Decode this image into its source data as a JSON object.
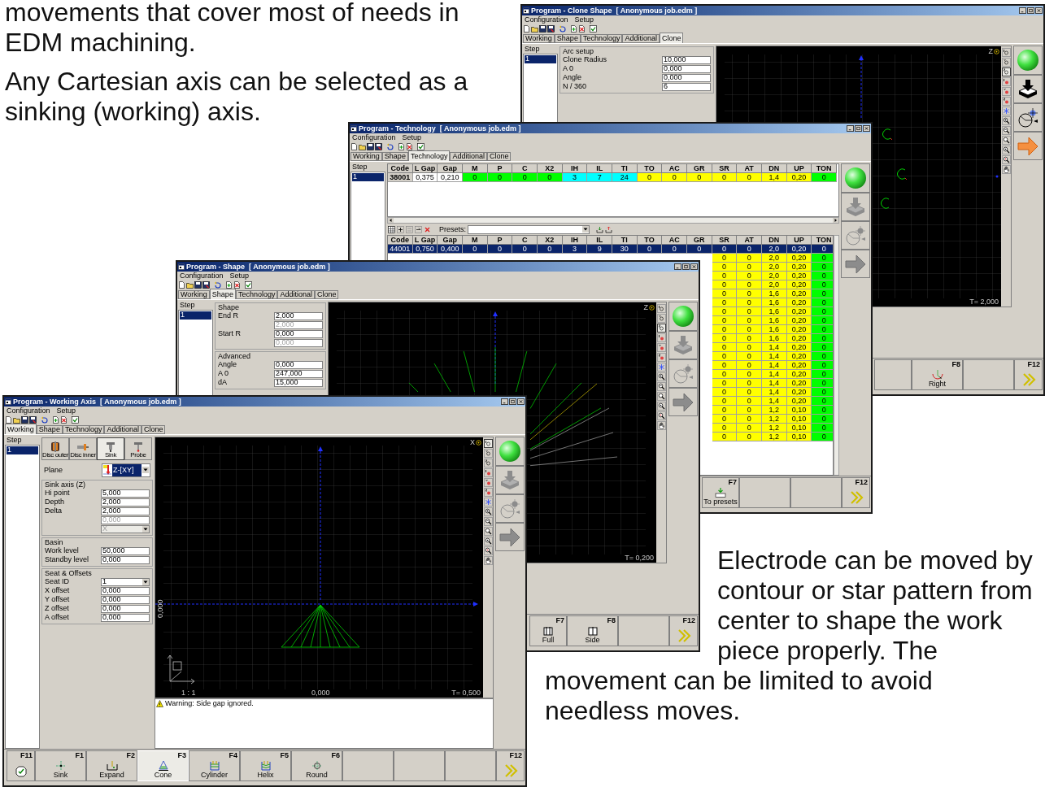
{
  "captions": [
    {
      "text": "movements that cover most of needs in EDM machining."
    },
    {
      "text": "Any Cartesian axis can be selected as a sinking (working) axis."
    },
    {
      "text": "Electrode can be moved by contour or star pattern from center to shape the work piece properly. The"
    },
    {
      "text": "movement can be limited to avoid needless moves."
    }
  ],
  "windows": [
    {
      "kind": "clone",
      "title": "Program - Clone Shape  [ Anonymous job.edm ]",
      "menu": [
        "Configuration",
        "Setup"
      ],
      "tabs": [
        {
          "label": "Working",
          "selected": false
        },
        {
          "label": "Shape",
          "selected": false
        },
        {
          "label": "Technology",
          "selected": false
        },
        {
          "label": "Additional",
          "selected": false
        },
        {
          "label": "Clone",
          "selected": true
        }
      ],
      "step_header": "Step",
      "steps": [
        {
          "label": "1",
          "selected": true
        }
      ],
      "groups": [
        {
          "title": "Arc setup",
          "fields": [
            {
              "label": "Clone Radius",
              "value": "10,000",
              "kind": "text",
              "disabled": false
            },
            {
              "label": "A 0",
              "value": "0,000",
              "kind": "text",
              "disabled": false
            },
            {
              "label": "Angle",
              "value": "0,000",
              "kind": "text",
              "disabled": false
            },
            {
              "label": "N / 360",
              "value": "6",
              "kind": "text",
              "disabled": false
            }
          ]
        }
      ],
      "canvas": {
        "axis_label": "Z",
        "time": "T= 2,000"
      },
      "views": [
        {
          "selected": false
        },
        {
          "selected": false
        },
        {
          "selected": true
        },
        {
          "selected": false
        },
        {
          "selected": false
        },
        {
          "selected": false
        }
      ],
      "actions": [
        {
          "disabled": false
        },
        {
          "disabled": false
        },
        {
          "disabled": false
        }
      ],
      "fkeys": [
        {
          "kind": "blank",
          "selected": false
        },
        {
          "kind": "key",
          "key": "F8",
          "label": "Right",
          "selected": false
        },
        {
          "kind": "blank",
          "selected": false
        },
        {
          "kind": "next",
          "key": "F12",
          "selected": false
        }
      ]
    },
    {
      "kind": "technology",
      "title": "Program - Technology  [ Anonymous job.edm ]",
      "menu": [
        "Configuration",
        "Setup"
      ],
      "tabs": [
        {
          "label": "Working",
          "selected": false
        },
        {
          "label": "Shape",
          "selected": false
        },
        {
          "label": "Technology",
          "selected": true
        },
        {
          "label": "Additional",
          "selected": false
        },
        {
          "label": "Clone",
          "selected": false
        }
      ],
      "step_header": "Step",
      "steps": [
        {
          "label": "1",
          "selected": true
        }
      ],
      "tables": [
        {
          "columns": [
            {
              "label": "Code"
            },
            {
              "label": "L Gap"
            },
            {
              "label": "Gap"
            },
            {
              "label": "M",
              "color": "#00ff00"
            },
            {
              "label": "P",
              "color": "#00ff00"
            },
            {
              "label": "C",
              "color": "#00ff00"
            },
            {
              "label": "X2",
              "color": "#00ff00"
            },
            {
              "label": "IH",
              "color": "#00ffff"
            },
            {
              "label": "IL",
              "color": "#00ffff"
            },
            {
              "label": "TI",
              "color": "#00ffff"
            },
            {
              "label": "TO",
              "color": "#ffff00"
            },
            {
              "label": "AC",
              "color": "#ffff00"
            },
            {
              "label": "GR",
              "color": "#ffff00"
            },
            {
              "label": "SR",
              "color": "#ffff00"
            },
            {
              "label": "AT",
              "color": "#ffff00"
            },
            {
              "label": "DN",
              "color": "#ffff00"
            },
            {
              "label": "UP",
              "color": "#ffff00"
            },
            {
              "label": "TON",
              "color": "#00ff00"
            }
          ],
          "rows": [
            {
              "selected": false,
              "cells": [
                "38001",
                "0,375",
                "0,210",
                "0",
                "0",
                "0",
                "0",
                "3",
                "7",
                "24",
                "0",
                "0",
                "0",
                "0",
                "0",
                "1,4",
                "0,20",
                "0"
              ]
            }
          ]
        },
        {
          "columns": [
            {
              "label": "Code"
            },
            {
              "label": "L Gap"
            },
            {
              "label": "Gap"
            },
            {
              "label": "M"
            },
            {
              "label": "P"
            },
            {
              "label": "C"
            },
            {
              "label": "X2"
            },
            {
              "label": "IH"
            },
            {
              "label": "IL"
            },
            {
              "label": "TI"
            },
            {
              "label": "TO"
            },
            {
              "label": "AC"
            },
            {
              "label": "GR"
            },
            {
              "label": "SR",
              "color": "#ffff00"
            },
            {
              "label": "AT",
              "color": "#ffff00"
            },
            {
              "label": "DN",
              "color": "#ffff00"
            },
            {
              "label": "UP",
              "color": "#ffff00"
            },
            {
              "label": "TON",
              "color": "#00ff00"
            }
          ],
          "rows": [
            {
              "selected": true,
              "cells": [
                "44001",
                "0,750",
                "0,400",
                "0",
                "0",
                "0",
                "0",
                "3",
                "9",
                "30",
                "0",
                "0",
                "0",
                "0",
                "0",
                "2,0",
                "0,20",
                "0"
              ]
            },
            {
              "selected": false,
              "cells": [
                "0",
                "0",
                "2,0",
                "0,20",
                "0"
              ]
            },
            {
              "selected": false,
              "cells": [
                "0",
                "0",
                "2,0",
                "0,20",
                "0"
              ]
            },
            {
              "selected": false,
              "cells": [
                "0",
                "0",
                "2,0",
                "0,20",
                "0"
              ]
            },
            {
              "selected": false,
              "cells": [
                "0",
                "0",
                "2,0",
                "0,20",
                "0"
              ]
            },
            {
              "selected": false,
              "cells": [
                "0",
                "0",
                "1,6",
                "0,20",
                "0"
              ]
            },
            {
              "selected": false,
              "cells": [
                "0",
                "0",
                "1,6",
                "0,20",
                "0"
              ]
            },
            {
              "selected": false,
              "cells": [
                "0",
                "0",
                "1,6",
                "0,20",
                "0"
              ]
            },
            {
              "selected": false,
              "cells": [
                "0",
                "0",
                "1,6",
                "0,20",
                "0"
              ]
            },
            {
              "selected": false,
              "cells": [
                "0",
                "0",
                "1,6",
                "0,20",
                "0"
              ]
            },
            {
              "selected": false,
              "cells": [
                "0",
                "0",
                "1,6",
                "0,20",
                "0"
              ]
            },
            {
              "selected": false,
              "cells": [
                "0",
                "0",
                "1,4",
                "0,20",
                "0"
              ]
            },
            {
              "selected": false,
              "cells": [
                "0",
                "0",
                "1,4",
                "0,20",
                "0"
              ]
            },
            {
              "selected": false,
              "cells": [
                "0",
                "0",
                "1,4",
                "0,20",
                "0"
              ]
            },
            {
              "selected": false,
              "cells": [
                "0",
                "0",
                "1,4",
                "0,20",
                "0"
              ]
            },
            {
              "selected": false,
              "cells": [
                "0",
                "0",
                "1,4",
                "0,20",
                "0"
              ]
            },
            {
              "selected": false,
              "cells": [
                "0",
                "0",
                "1,4",
                "0,20",
                "0"
              ]
            },
            {
              "selected": false,
              "cells": [
                "0",
                "0",
                "1,4",
                "0,20",
                "0"
              ]
            },
            {
              "selected": false,
              "cells": [
                "0",
                "0",
                "1,2",
                "0,10",
                "0"
              ]
            },
            {
              "selected": false,
              "cells": [
                "0",
                "0",
                "1,2",
                "0,10",
                "0"
              ]
            },
            {
              "selected": false,
              "cells": [
                "0",
                "0",
                "1,2",
                "0,10",
                "0"
              ]
            },
            {
              "selected": false,
              "cells": [
                "0",
                "0",
                "1,2",
                "0,10",
                "0"
              ]
            }
          ]
        }
      ],
      "presets": {
        "label": "Presets:"
      },
      "actions": [
        {
          "disabled": true
        },
        {
          "disabled": true
        },
        {
          "disabled": true
        }
      ],
      "fkeys": [
        {
          "kind": "key",
          "key": "F7",
          "label": "To presets",
          "selected": false
        },
        {
          "kind": "blank",
          "selected": false
        },
        {
          "kind": "blank",
          "selected": false
        },
        {
          "kind": "next",
          "key": "F12",
          "selected": false
        }
      ]
    },
    {
      "kind": "shape",
      "title": "Program - Shape  [ Anonymous job.edm ]",
      "menu": [
        "Configuration",
        "Setup"
      ],
      "tabs": [
        {
          "label": "Working",
          "selected": false
        },
        {
          "label": "Shape",
          "selected": true
        },
        {
          "label": "Technology",
          "selected": false
        },
        {
          "label": "Additional",
          "selected": false
        },
        {
          "label": "Clone",
          "selected": false
        }
      ],
      "step_header": "Step",
      "steps": [
        {
          "label": "1",
          "selected": true
        }
      ],
      "groups": [
        {
          "title": "Shape",
          "fields": [
            {
              "label": "End R",
              "value": "2,000",
              "kind": "text",
              "disabled": false
            },
            {
              "value": "2,000",
              "kind": "text",
              "disabled": true
            },
            {
              "label": "Start R",
              "value": "0,000",
              "kind": "text",
              "disabled": false
            },
            {
              "value": "0,000",
              "kind": "text",
              "disabled": true
            }
          ]
        },
        {
          "title": "Advanced",
          "fields": [
            {
              "label": "Angle",
              "value": "0,000",
              "kind": "text",
              "disabled": false
            },
            {
              "label": "A 0",
              "value": "247,000",
              "kind": "text",
              "disabled": false
            },
            {
              "label": "dA",
              "value": "15,000",
              "kind": "text",
              "disabled": false
            }
          ]
        }
      ],
      "canvas": {
        "axis_label": "Z",
        "time": "T= 0,200"
      },
      "views": [
        {
          "selected": false
        },
        {
          "selected": false
        },
        {
          "selected": true
        },
        {
          "selected": false
        },
        {
          "selected": false
        },
        {
          "selected": false
        }
      ],
      "actions": [
        {
          "disabled": true
        },
        {
          "disabled": true
        },
        {
          "disabled": true
        }
      ],
      "fkeys": [
        {
          "kind": "key",
          "key": "F7",
          "label": "Full",
          "selected": false
        },
        {
          "kind": "key",
          "key": "F8",
          "label": "Side",
          "selected": false
        },
        {
          "kind": "blank",
          "selected": false
        },
        {
          "kind": "next",
          "key": "F12",
          "selected": false
        }
      ]
    },
    {
      "kind": "working",
      "title": "Program - Working Axis  [ Anonymous job.edm ]",
      "menu": [
        "Configuration",
        "Setup"
      ],
      "tabs": [
        {
          "label": "Working",
          "selected": true
        },
        {
          "label": "Shape",
          "selected": false
        },
        {
          "label": "Technology",
          "selected": false
        },
        {
          "label": "Additional",
          "selected": false
        },
        {
          "label": "Clone",
          "selected": false
        }
      ],
      "step_header": "Step",
      "steps": [
        {
          "label": "1",
          "selected": true
        }
      ],
      "tools": [
        {
          "label": "Disc outer",
          "selected": false
        },
        {
          "label": "Disc inner",
          "selected": false
        },
        {
          "label": "Sink",
          "selected": true
        },
        {
          "label": "Probe",
          "selected": false
        }
      ],
      "plane": {
        "label": "Plane",
        "value": "Z-[XY]"
      },
      "groups": [
        {
          "title": "Sink axis (Z)",
          "fields": [
            {
              "label": "Hi point",
              "value": "5,000",
              "kind": "text",
              "disabled": false
            },
            {
              "label": "Depth",
              "value": "2,000",
              "kind": "text",
              "disabled": false
            },
            {
              "label": "Delta",
              "value": "2,000",
              "kind": "text",
              "disabled": false
            },
            {
              "value": "0,000",
              "kind": "text",
              "disabled": true
            },
            {
              "value": "X",
              "kind": "dropdown",
              "disabled": true
            }
          ]
        },
        {
          "title": "Basin",
          "fields": [
            {
              "label": "Work level",
              "value": "50,000",
              "kind": "text",
              "disabled": false
            },
            {
              "label": "Standby level",
              "value": "0,000",
              "kind": "text",
              "disabled": false
            }
          ]
        },
        {
          "title": "Seat & Offsets",
          "fields": [
            {
              "label": "Seat ID",
              "value": "1",
              "kind": "dropdown",
              "disabled": false
            },
            {
              "label": "X offset",
              "value": "0,000",
              "kind": "text",
              "disabled": false
            },
            {
              "label": "Y offset",
              "value": "0,000",
              "kind": "text",
              "disabled": false
            },
            {
              "label": "Z offset",
              "value": "0,000",
              "kind": "text",
              "disabled": false
            },
            {
              "label": "A offset",
              "value": "0,000",
              "kind": "text",
              "disabled": false
            }
          ]
        }
      ],
      "canvas": {
        "axis_label": "X",
        "y_reading": "0,000",
        "scale": "1 : 1",
        "x_reading": "0,000",
        "time": "T= 0,500"
      },
      "message": "Warning: Side gap ignored.",
      "views": [
        {
          "selected": true
        },
        {
          "selected": false
        },
        {
          "selected": false
        },
        {
          "selected": false
        },
        {
          "selected": false
        },
        {
          "selected": false
        }
      ],
      "actions": [
        {
          "disabled": true
        },
        {
          "disabled": true
        },
        {
          "disabled": true
        }
      ],
      "fkeys": [
        {
          "kind": "ok",
          "key": "F11",
          "selected": false
        },
        {
          "kind": "key",
          "key": "F1",
          "label": "Sink",
          "selected": false
        },
        {
          "kind": "key",
          "key": "F2",
          "label": "Expand",
          "selected": false
        },
        {
          "kind": "key",
          "key": "F3",
          "label": "Cone",
          "selected": true
        },
        {
          "kind": "key",
          "key": "F4",
          "label": "Cylinder",
          "selected": false
        },
        {
          "kind": "key",
          "key": "F5",
          "label": "Helix",
          "selected": false
        },
        {
          "kind": "key",
          "key": "F6",
          "label": "Round",
          "selected": false
        },
        {
          "kind": "blank",
          "selected": false
        },
        {
          "kind": "blank",
          "selected": false
        },
        {
          "kind": "blank",
          "selected": false
        },
        {
          "kind": "next",
          "key": "F12",
          "selected": false
        }
      ]
    }
  ]
}
